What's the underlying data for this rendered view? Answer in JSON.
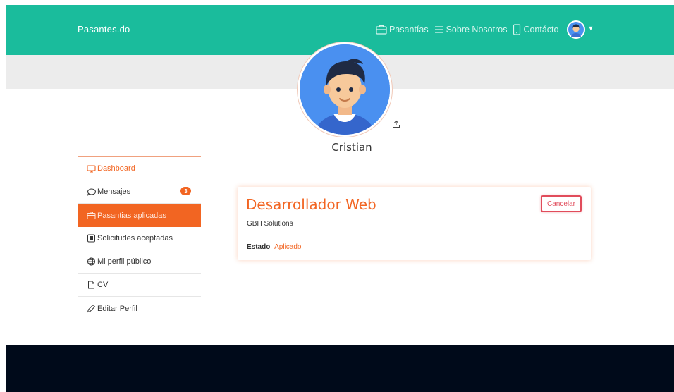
{
  "brand": "Pasantes.do",
  "nav": {
    "items": [
      {
        "label": "Pasantías",
        "icon": "briefcase-icon"
      },
      {
        "label": "Sobre Nosotros",
        "icon": "menu-lines-icon"
      },
      {
        "label": "Contácto",
        "icon": "phone-icon"
      }
    ],
    "avatar_icon": "user-avatar-icon",
    "caret_icon": "caret-down-icon"
  },
  "profile": {
    "name": "Cristian",
    "upload_icon": "upload-icon"
  },
  "sidebar": {
    "items": [
      {
        "label": "Dashboard",
        "icon": "monitor-icon",
        "state": "current"
      },
      {
        "label": "Mensajes",
        "icon": "chat-bubble-icon",
        "badge": "3"
      },
      {
        "label": "Pasantias aplicadas",
        "icon": "briefcase-icon",
        "state": "active"
      },
      {
        "label": "Solicitudes aceptadas",
        "icon": "stamp-icon"
      },
      {
        "label": "Mi perfil público",
        "icon": "globe-icon"
      },
      {
        "label": "CV",
        "icon": "document-icon"
      },
      {
        "label": "Editar Perfil",
        "icon": "pencil-icon"
      }
    ]
  },
  "application": {
    "title": "Desarrollador Web",
    "company": "GBH Solutions",
    "status_label": "Estado",
    "status_value": "Aplicado",
    "cancel_label": "Cancelar"
  },
  "colors": {
    "primary": "#1abc9c",
    "accent": "#f26522",
    "danger": "#e14c5b",
    "footer": "#000a1a",
    "cover": "#ececec"
  }
}
